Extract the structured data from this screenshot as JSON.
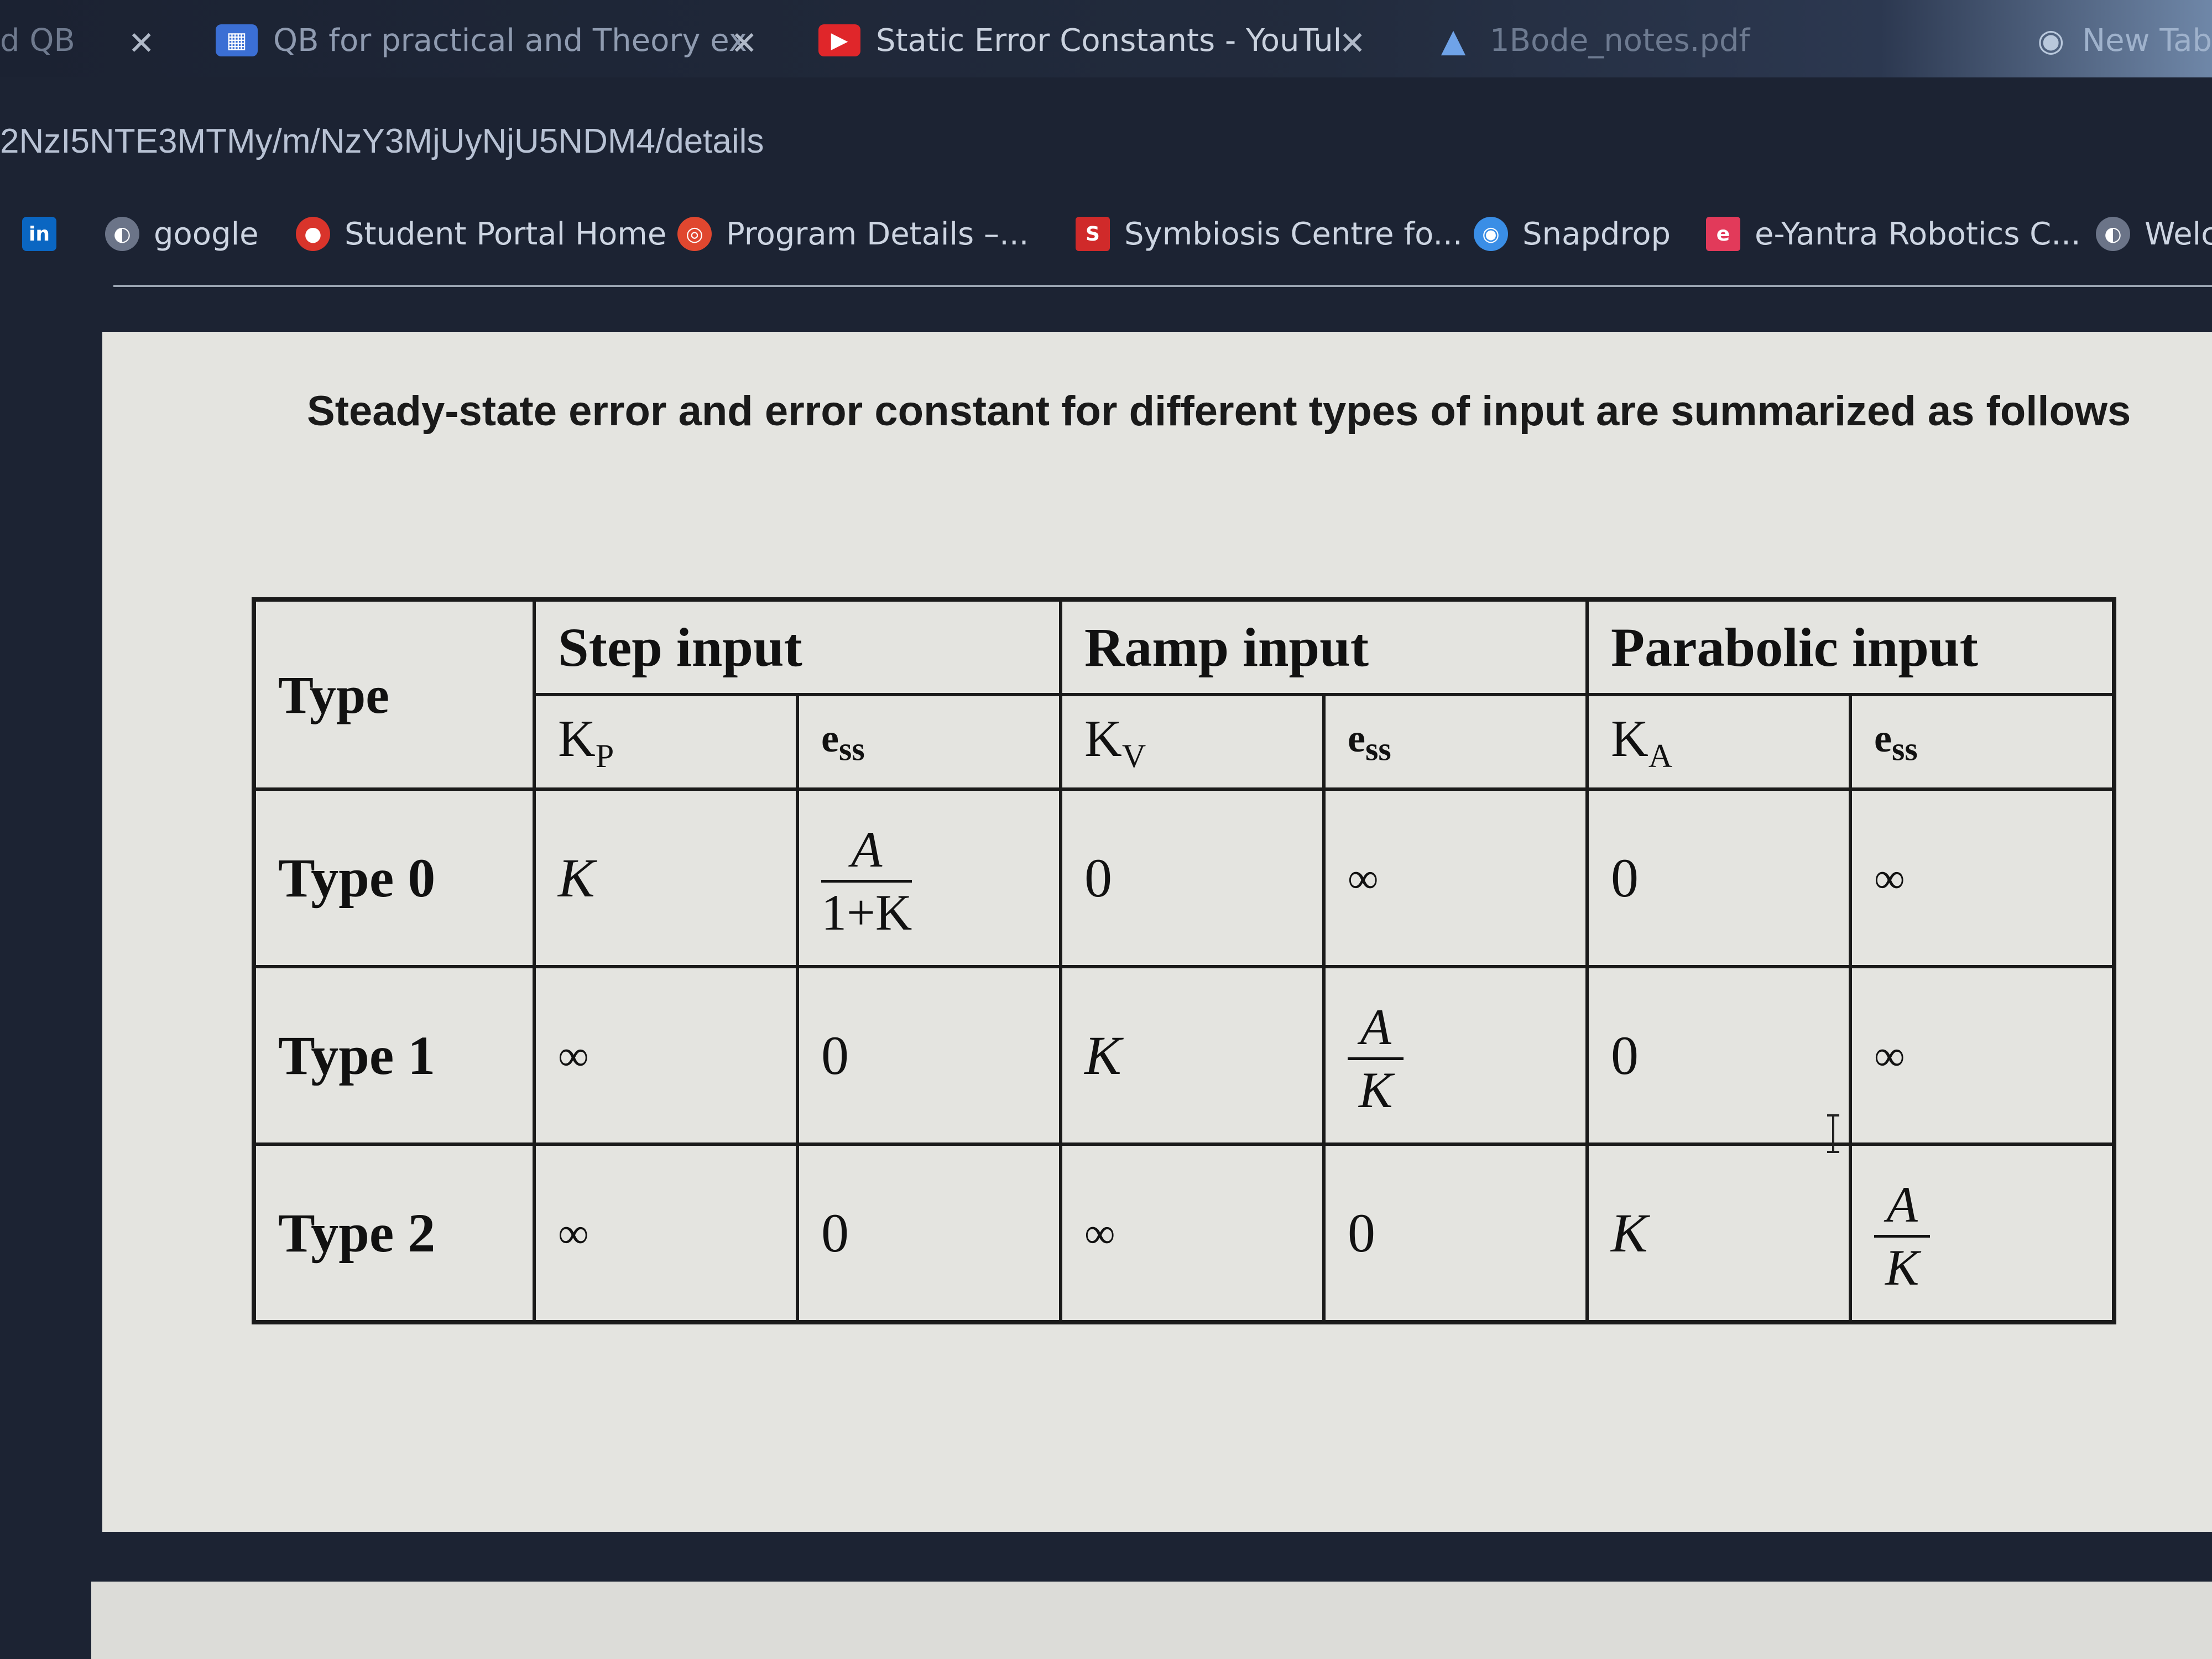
{
  "tabs": [
    {
      "label": "d QB",
      "icon": "tab-icon",
      "closable": true,
      "active": false
    },
    {
      "label": "QB for practical and Theory ex",
      "icon": "qb-doc-icon",
      "closable": true,
      "active": false
    },
    {
      "label": "Static Error Constants - YouTul",
      "icon": "youtube-icon",
      "closable": true,
      "active": true
    },
    {
      "label": "1Bode_notes.pdf",
      "icon": "drive-icon",
      "closable": false,
      "active": false
    },
    {
      "label": "New Tab",
      "icon": "new-tab-icon",
      "closable": false,
      "active": false
    }
  ],
  "address": {
    "url": "2NzI5NTE3MTMy/m/NzY3MjUyNjU5NDM4/details"
  },
  "bookmarks": [
    {
      "label": "",
      "icon": "linkedin-icon",
      "color": "#0a66c2",
      "glyph": "in"
    },
    {
      "label": "google",
      "icon": "globe-icon",
      "color": "#6b7488",
      "glyph": "◐"
    },
    {
      "label": "Student Portal Home",
      "icon": "portal-icon",
      "color": "#d9342b",
      "glyph": "●"
    },
    {
      "label": "Program Details –...",
      "icon": "program-icon",
      "color": "#e0472f",
      "glyph": "◎"
    },
    {
      "label": "Symbiosis Centre fo...",
      "icon": "symbiosis-icon",
      "color": "#d02a2a",
      "glyph": "S"
    },
    {
      "label": "Snapdrop",
      "icon": "snapdrop-icon",
      "color": "#3a8ee6",
      "glyph": "◉"
    },
    {
      "label": "e-Yantra Robotics C...",
      "icon": "eyantra-icon",
      "color": "#e23a5a",
      "glyph": "e"
    },
    {
      "label": "Welc",
      "icon": "globe-icon",
      "color": "#6b7488",
      "glyph": "◐"
    }
  ],
  "content": {
    "heading": "Steady-state error and error constant for different types of input are summarized as follows",
    "table": {
      "type_header": "Type",
      "groups": [
        "Step input",
        "Ramp input",
        "Parabolic input"
      ],
      "sub_headers": [
        {
          "main": "K",
          "sub": "P"
        },
        {
          "main": "e",
          "sub": "ss"
        },
        {
          "main": "K",
          "sub": "V"
        },
        {
          "main": "e",
          "sub": "ss"
        },
        {
          "main": "K",
          "sub": "A"
        },
        {
          "main": "e",
          "sub": "ss"
        }
      ],
      "rows": [
        {
          "label": "Type 0",
          "cells": [
            "K",
            {
              "num": "A",
              "den": "1+K"
            },
            "0",
            "∞",
            "0",
            "∞"
          ]
        },
        {
          "label": "Type 1",
          "cells": [
            "∞",
            "0",
            "K",
            {
              "num": "A",
              "den": "K"
            },
            "0",
            "∞"
          ]
        },
        {
          "label": "Type 2",
          "cells": [
            "∞",
            "0",
            "∞",
            "0",
            "K",
            {
              "num": "A",
              "den": "K"
            }
          ]
        }
      ]
    }
  },
  "colors": {
    "chrome_bg": "#1c2333",
    "page_bg": "#e4e4e0",
    "text": "#111111"
  }
}
